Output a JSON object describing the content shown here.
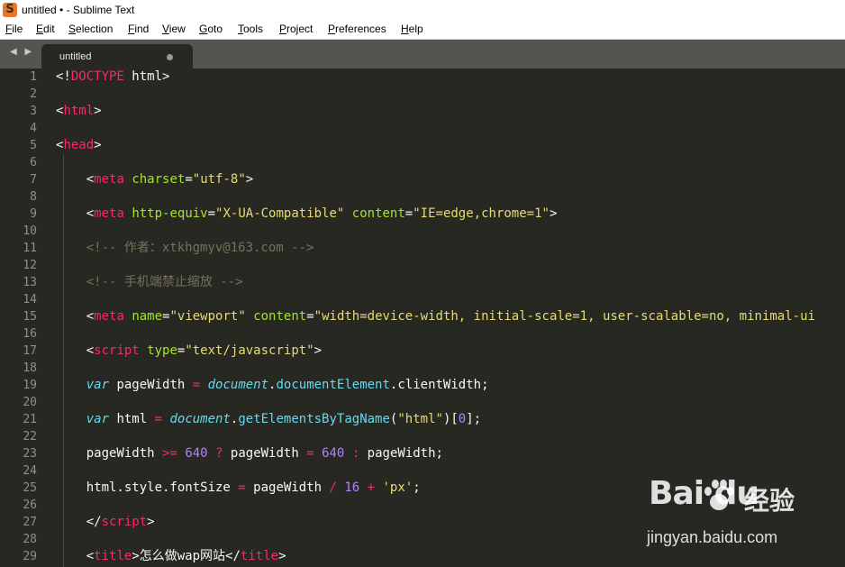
{
  "window": {
    "title": "untitled • - Sublime Text",
    "app_icon_glyph": "S"
  },
  "menu": [
    "File",
    "Edit",
    "Selection",
    "Find",
    "View",
    "Goto",
    "Tools",
    "Project",
    "Preferences",
    "Help"
  ],
  "tabbar": {
    "nav_arrows": "◀ ▶",
    "tab_label": "untitled",
    "tab_modified": true
  },
  "colors": {
    "background": "#272822",
    "tag": "#f92672",
    "attribute": "#a6e22e",
    "string": "#e6db74",
    "comment": "#75715e",
    "support": "#66d9ef",
    "number": "#ae81ff",
    "line_number": "#8f908a"
  },
  "line_numbers": [
    "1",
    "2",
    "3",
    "4",
    "5",
    "6",
    "7",
    "8",
    "9",
    "10",
    "11",
    "12",
    "13",
    "14",
    "15",
    "16",
    "17",
    "18",
    "19",
    "20",
    "21",
    "22",
    "23",
    "24",
    "25",
    "26",
    "27",
    "28",
    "29"
  ],
  "code_lines": [
    [
      [
        "pu",
        "<!"
      ],
      [
        "tg",
        "DOCTYPE"
      ],
      [
        "pl",
        " html"
      ],
      [
        "pu",
        ">"
      ]
    ],
    [],
    [
      [
        "pu",
        "<"
      ],
      [
        "tg",
        "html"
      ],
      [
        "pu",
        ">"
      ]
    ],
    [],
    [
      [
        "pu",
        "<"
      ],
      [
        "tg",
        "head"
      ],
      [
        "pu",
        ">"
      ]
    ],
    [],
    [
      [
        "pl",
        "    "
      ],
      [
        "pu",
        "<"
      ],
      [
        "tg",
        "meta"
      ],
      [
        "pl",
        " "
      ],
      [
        "at",
        "charset"
      ],
      [
        "pu",
        "="
      ],
      [
        "st",
        "\"utf-8\""
      ],
      [
        "pu",
        ">"
      ]
    ],
    [],
    [
      [
        "pl",
        "    "
      ],
      [
        "pu",
        "<"
      ],
      [
        "tg",
        "meta"
      ],
      [
        "pl",
        " "
      ],
      [
        "at",
        "http-equiv"
      ],
      [
        "pu",
        "="
      ],
      [
        "st",
        "\"X-UA-Compatible\""
      ],
      [
        "pl",
        " "
      ],
      [
        "at",
        "content"
      ],
      [
        "pu",
        "="
      ],
      [
        "st",
        "\"IE=edge,chrome=1\""
      ],
      [
        "pu",
        ">"
      ]
    ],
    [],
    [
      [
        "pl",
        "    "
      ],
      [
        "cm",
        "<!-- 作者：xtkhgmyv@163.com -->"
      ]
    ],
    [],
    [
      [
        "pl",
        "    "
      ],
      [
        "cm",
        "<!-- 手机端禁止缩放 -->"
      ]
    ],
    [],
    [
      [
        "pl",
        "    "
      ],
      [
        "pu",
        "<"
      ],
      [
        "tg",
        "meta"
      ],
      [
        "pl",
        " "
      ],
      [
        "at",
        "name"
      ],
      [
        "pu",
        "="
      ],
      [
        "st",
        "\"viewport\""
      ],
      [
        "pl",
        " "
      ],
      [
        "at",
        "content"
      ],
      [
        "pu",
        "="
      ],
      [
        "st",
        "\"width=device-width, initial-scale=1, user-scalable=no, minimal-ui"
      ]
    ],
    [],
    [
      [
        "pl",
        "    "
      ],
      [
        "pu",
        "<"
      ],
      [
        "tg",
        "script"
      ],
      [
        "pl",
        " "
      ],
      [
        "at",
        "type"
      ],
      [
        "pu",
        "="
      ],
      [
        "st",
        "\"text/javascript\""
      ],
      [
        "pu",
        ">"
      ]
    ],
    [],
    [
      [
        "pl",
        "    "
      ],
      [
        "sv",
        "var"
      ],
      [
        "pl",
        " pageWidth "
      ],
      [
        "op",
        "="
      ],
      [
        "pl",
        " "
      ],
      [
        "sv",
        "document"
      ],
      [
        "pl",
        "."
      ],
      [
        "fn",
        "documentElement"
      ],
      [
        "pl",
        ".clientWidth;"
      ]
    ],
    [],
    [
      [
        "pl",
        "    "
      ],
      [
        "sv",
        "var"
      ],
      [
        "pl",
        " html "
      ],
      [
        "op",
        "="
      ],
      [
        "pl",
        " "
      ],
      [
        "sv",
        "document"
      ],
      [
        "pl",
        "."
      ],
      [
        "fn",
        "getElementsByTagName"
      ],
      [
        "pl",
        "("
      ],
      [
        "st",
        "\"html\""
      ],
      [
        "pl",
        ")["
      ],
      [
        "nm",
        "0"
      ],
      [
        "pl",
        "];"
      ]
    ],
    [],
    [
      [
        "pl",
        "    pageWidth "
      ],
      [
        "op",
        ">="
      ],
      [
        "pl",
        " "
      ],
      [
        "nm",
        "640"
      ],
      [
        "pl",
        " "
      ],
      [
        "op",
        "?"
      ],
      [
        "pl",
        " pageWidth "
      ],
      [
        "op",
        "="
      ],
      [
        "pl",
        " "
      ],
      [
        "nm",
        "640"
      ],
      [
        "pl",
        " "
      ],
      [
        "op",
        ":"
      ],
      [
        "pl",
        " pageWidth;"
      ]
    ],
    [],
    [
      [
        "pl",
        "    html.style.fontSize "
      ],
      [
        "op",
        "="
      ],
      [
        "pl",
        " pageWidth "
      ],
      [
        "op",
        "/"
      ],
      [
        "pl",
        " "
      ],
      [
        "nm",
        "16"
      ],
      [
        "pl",
        " "
      ],
      [
        "op",
        "+"
      ],
      [
        "pl",
        " "
      ],
      [
        "st",
        "'px'"
      ],
      [
        "pl",
        ";"
      ]
    ],
    [],
    [
      [
        "pl",
        "    "
      ],
      [
        "pu",
        "</"
      ],
      [
        "tg",
        "script"
      ],
      [
        "pu",
        ">"
      ]
    ],
    [],
    [
      [
        "pl",
        "    "
      ],
      [
        "pu",
        "<"
      ],
      [
        "tg",
        "title"
      ],
      [
        "pu",
        ">"
      ],
      [
        "pl",
        "怎么做wap网站"
      ],
      [
        "pu",
        "</"
      ],
      [
        "tg",
        "title"
      ],
      [
        "pu",
        ">"
      ]
    ]
  ],
  "watermark": {
    "logo_text": "Bai du",
    "cn_text": "经验",
    "url": "jingyan.baidu.com"
  }
}
